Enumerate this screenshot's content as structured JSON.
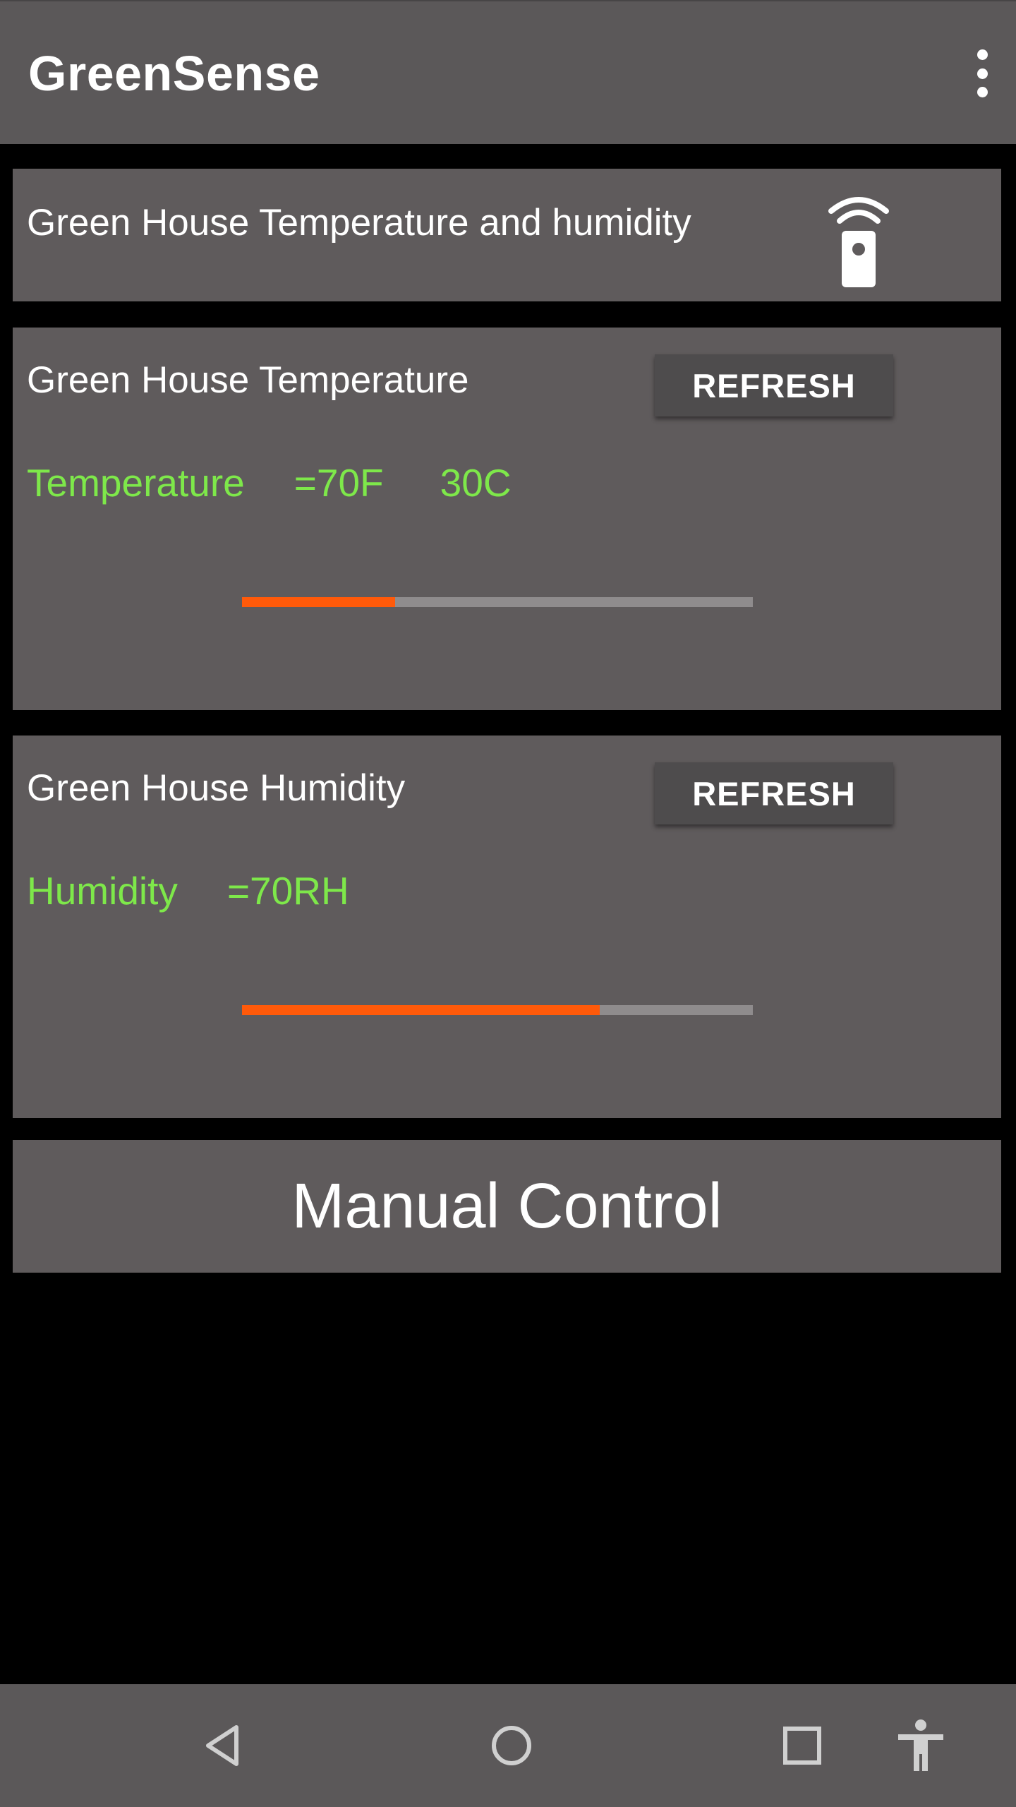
{
  "app": {
    "title": "GreenSense"
  },
  "header_card": {
    "text": "Green House Temperature and humidity",
    "icon": "remote-icon"
  },
  "temperature_card": {
    "title": "Green House Temperature",
    "refresh_label": "REFRESH",
    "reading_label": "Temperature",
    "value_f": "=70F",
    "value_c": "30C",
    "progress_fraction": 0.3
  },
  "humidity_card": {
    "title": "Green House Humidity",
    "refresh_label": "REFRESH",
    "reading_label": "Humidity",
    "value": "=70RH",
    "progress_fraction": 0.7
  },
  "manual_control": {
    "label": "Manual Control"
  },
  "colors": {
    "accent_green": "#7ee84a",
    "progress_orange": "#ff5a0a",
    "card_bg": "#5f5b5c",
    "bar_bg": "#5b5859"
  },
  "navbar": {
    "icons": [
      "back-icon",
      "home-icon",
      "recents-icon",
      "accessibility-icon"
    ]
  }
}
